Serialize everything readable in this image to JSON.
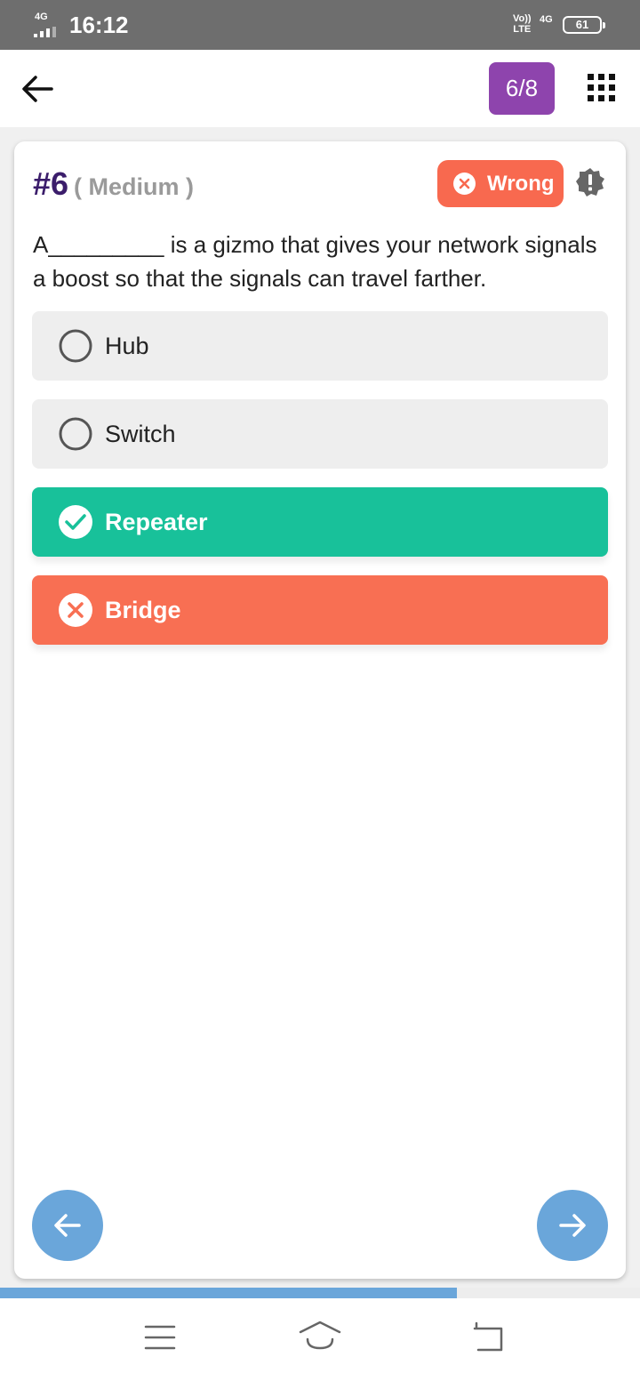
{
  "status_bar": {
    "network_type": "4G",
    "time": "16:12",
    "volte_label": "Vo)) LTE",
    "network_type_right": "4G",
    "battery": "61"
  },
  "app_bar": {
    "counter": "6/8",
    "back_icon": "arrow-left-icon",
    "grid_icon": "grid-icon"
  },
  "question": {
    "number": "#6",
    "difficulty": "( Medium )",
    "result_label": "Wrong",
    "text": "A_________ is a gizmo that gives your network signals a boost so that the signals can travel farther.",
    "options": [
      {
        "label": "Hub",
        "state": "unselected",
        "icon": "radio-empty-icon"
      },
      {
        "label": "Switch",
        "state": "unselected",
        "icon": "radio-empty-icon"
      },
      {
        "label": "Repeater",
        "state": "correct",
        "icon": "check-circle-icon"
      },
      {
        "label": "Bridge",
        "state": "wrong",
        "icon": "x-circle-icon"
      }
    ]
  },
  "progress": {
    "value": 0.714
  },
  "colors": {
    "status_bar": "#6e6e6e",
    "counter_bg": "#8e44ad",
    "wrong": "#f8694f",
    "correct": "#18c19a",
    "fab": "#6aa6da",
    "question_number": "#3b1d6b"
  }
}
